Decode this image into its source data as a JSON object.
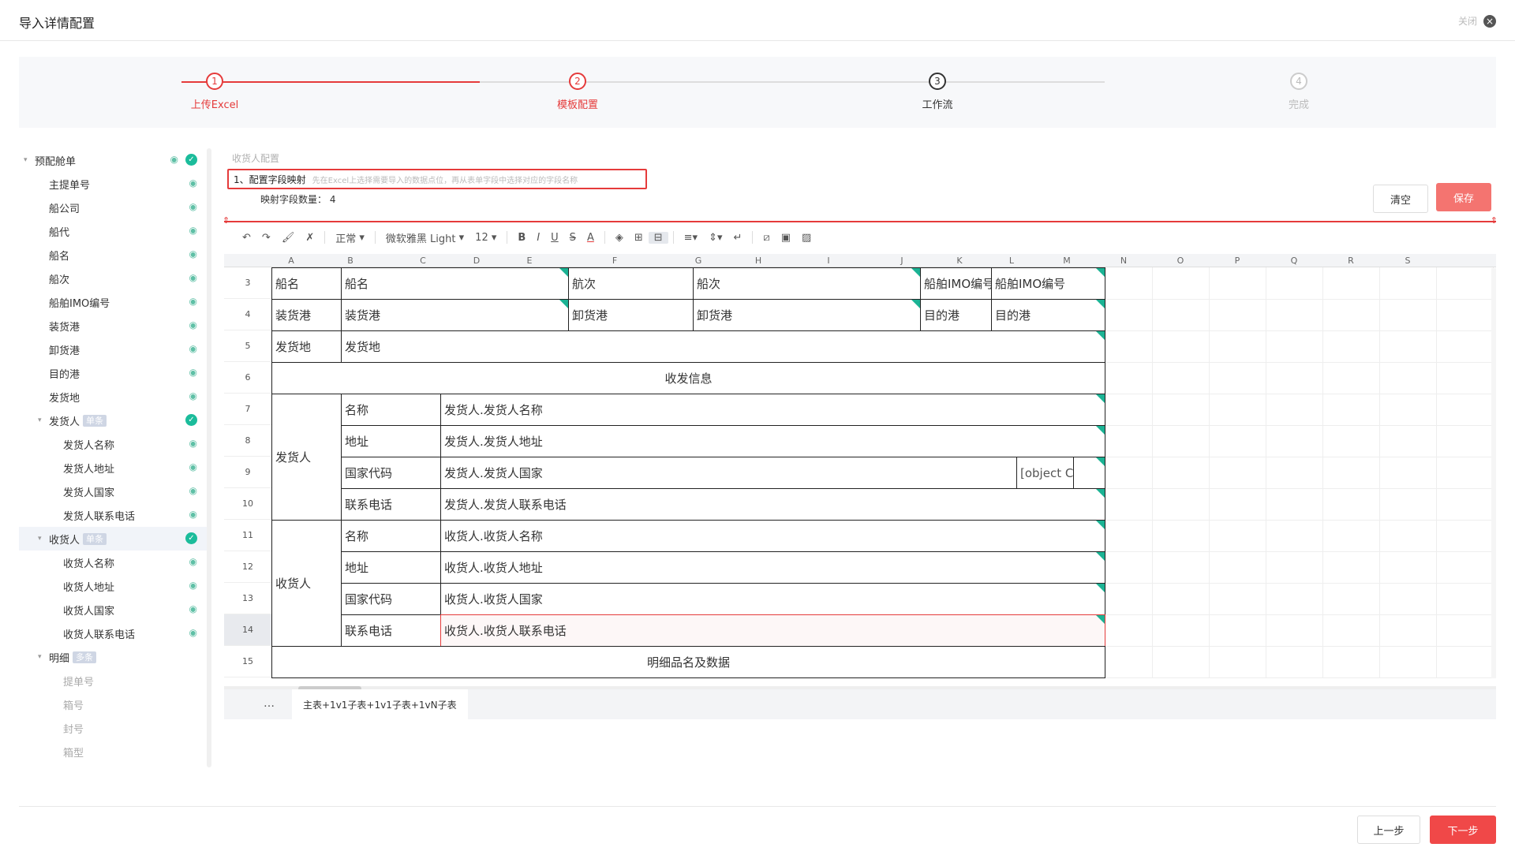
{
  "header": {
    "title": "导入详情配置",
    "close_label": "关闭"
  },
  "steps": [
    {
      "num": "1",
      "label": "上传Excel",
      "state": "done"
    },
    {
      "num": "2",
      "label": "模板配置",
      "state": "active"
    },
    {
      "num": "3",
      "label": "工作流",
      "state": "pending"
    },
    {
      "num": "4",
      "label": "完成",
      "state": "disabled"
    }
  ],
  "colors": {
    "accent": "#e53b3b",
    "success": "#1bbc9b",
    "triangle": "#1bb394"
  },
  "sidebar": {
    "items": [
      {
        "label": "预配舱单",
        "level": 0,
        "caret": "▾",
        "check": true,
        "eye": true
      },
      {
        "label": "主提单号",
        "level": 1,
        "eye": true
      },
      {
        "label": "船公司",
        "level": 1,
        "eye": true
      },
      {
        "label": "船代",
        "level": 1,
        "eye": true
      },
      {
        "label": "船名",
        "level": 1,
        "eye": true
      },
      {
        "label": "船次",
        "level": 1,
        "eye": true
      },
      {
        "label": "船舶IMO编号",
        "level": 1,
        "eye": true
      },
      {
        "label": "装货港",
        "level": 1,
        "eye": true
      },
      {
        "label": "卸货港",
        "level": 1,
        "eye": true
      },
      {
        "label": "目的港",
        "level": 1,
        "eye": true
      },
      {
        "label": "发货地",
        "level": 1,
        "eye": true
      },
      {
        "label": "发货人",
        "level": 1,
        "caret": "▾",
        "tag": "单条",
        "check": true
      },
      {
        "label": "发货人名称",
        "level": 2,
        "eye": true
      },
      {
        "label": "发货人地址",
        "level": 2,
        "eye": true
      },
      {
        "label": "发货人国家",
        "level": 2,
        "eye": true
      },
      {
        "label": "发货人联系电话",
        "level": 2,
        "eye": true
      },
      {
        "label": "收货人",
        "level": 1,
        "caret": "▾",
        "tag": "单条",
        "check": true,
        "selected": true
      },
      {
        "label": "收货人名称",
        "level": 2,
        "eye": true
      },
      {
        "label": "收货人地址",
        "level": 2,
        "eye": true
      },
      {
        "label": "收货人国家",
        "level": 2,
        "eye": true
      },
      {
        "label": "收货人联系电话",
        "level": 2,
        "eye": true
      },
      {
        "label": "明细",
        "level": 1,
        "caret": "▾",
        "tag": "多条"
      },
      {
        "label": "提单号",
        "level": 2,
        "disabled": true
      },
      {
        "label": "箱号",
        "level": 2,
        "disabled": true
      },
      {
        "label": "封号",
        "level": 2,
        "disabled": true
      },
      {
        "label": "箱型",
        "level": 2,
        "disabled": true
      }
    ]
  },
  "config": {
    "section_title": "收货人配置",
    "mapping_title": "1、配置字段映射",
    "mapping_hint": "先在Excel上选择需要导入的数据点位，再从表单字段中选择对应的字段名称",
    "count_label": "映射字段数量：",
    "count_value": "4",
    "clear_label": "清空",
    "save_label": "保存"
  },
  "toolbar": {
    "style_label": "正常",
    "font_label": "微软雅黑 Light",
    "size_label": "12"
  },
  "sheet": {
    "columns": [
      "A",
      "B",
      "C",
      "D",
      "E",
      "F",
      "G",
      "H",
      "I",
      "J",
      "K",
      "L",
      "M",
      "N",
      "O",
      "P",
      "Q",
      "R",
      "S"
    ],
    "rows": [
      "3",
      "4",
      "5",
      "6",
      "7",
      "8",
      "9",
      "10",
      "11",
      "12",
      "13",
      "14",
      "15"
    ],
    "cells": {
      "r3_a": "船名",
      "r3_b": "船名",
      "r3_e": "航次",
      "r3_f": "船次",
      "r3_i": "船舶IMO编号",
      "r3_j": "船舶IMO编号",
      "r4_a": "装货港",
      "r4_b": "装货港",
      "r4_e": "卸货港",
      "r4_f": "卸货港",
      "r4_i": "目的港",
      "r4_j": "目的港",
      "r5_a": "发货地",
      "r5_b": "发货地",
      "r6": "收发信息",
      "shipper": "发货人",
      "r7_b": "名称",
      "r7_c": "发货人.发货人名称",
      "r8_b": "地址",
      "r8_c": "发货人.发货人地址",
      "r9_b": "国家代码",
      "r9_c": "发货人.发货人国家",
      "r9_l": "[object C",
      "r10_b": "联系电话",
      "r10_c": "发货人.发货人联系电话",
      "consignee": "收货人",
      "r11_b": "名称",
      "r11_c": "收货人.收货人名称",
      "r12_b": "地址",
      "r12_c": "收货人.收货人地址",
      "r13_b": "国家代码",
      "r13_c": "收货人.收货人国家",
      "r14_b": "联系电话",
      "r14_c": "收货人.收货人联系电话",
      "r15": "明细品名及数据"
    },
    "more_label": "…",
    "tab_label": "主表+1v1子表+1v1子表+1vN子表"
  },
  "footer": {
    "prev_label": "上一步",
    "next_label": "下一步"
  }
}
